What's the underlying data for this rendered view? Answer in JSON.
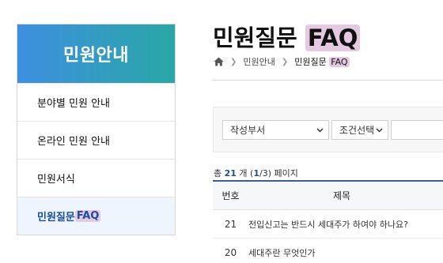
{
  "sidebar": {
    "title": "민원안내",
    "items": [
      {
        "label": "분야별 민원 안내"
      },
      {
        "label": "온라인 민원 안내"
      },
      {
        "label": "민원서식"
      },
      {
        "label_prefix": "민원질문 ",
        "label_highlight": "FAQ"
      }
    ]
  },
  "page": {
    "title_prefix": "민원질문 ",
    "title_highlight": "FAQ"
  },
  "breadcrumb": {
    "items": [
      "민원안내"
    ],
    "current_prefix": "민원질문 ",
    "current_highlight": "FAQ"
  },
  "search": {
    "dept_select": "작성부서",
    "condition_select": "조건선택",
    "keyword_value": ""
  },
  "summary": {
    "prefix": "총 ",
    "total": "21",
    "mid": " 개 (",
    "page_current": "1",
    "slash": "/",
    "page_total": "3",
    "suffix": ") 페이지"
  },
  "table": {
    "headers": {
      "no": "번호",
      "title": "제목"
    },
    "rows": [
      {
        "no": "21",
        "title": "전입신고는 반드시 세대주가 하여야 하나요?"
      },
      {
        "no": "20",
        "title": "세대주란 무엇인가"
      }
    ]
  },
  "colors": {
    "accent": "#1a4fa0",
    "gradient_start": "#3d8fe0",
    "gradient_end": "#2aa7a6",
    "highlight": "#e4c9e0"
  },
  "icons": {
    "home": "home-icon",
    "chevron": "chevron-down-icon"
  }
}
